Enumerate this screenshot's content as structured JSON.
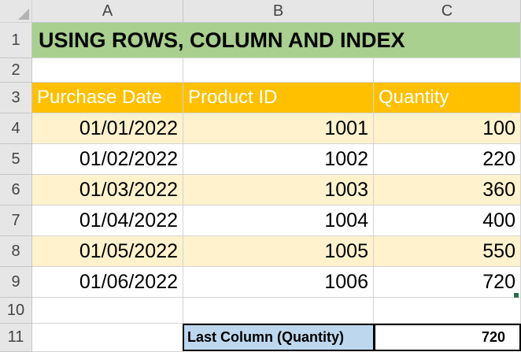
{
  "columns": [
    "A",
    "B",
    "C"
  ],
  "rows": [
    "1",
    "2",
    "3",
    "4",
    "5",
    "6",
    "7",
    "8",
    "9",
    "10",
    "11"
  ],
  "title": "USING ROWS, COLUMN AND INDEX",
  "table": {
    "headers": [
      "Purchase Date",
      "Product ID",
      "Quantity"
    ],
    "rows": [
      {
        "date": "01/01/2022",
        "id": "1001",
        "qty": "100"
      },
      {
        "date": "01/02/2022",
        "id": "1002",
        "qty": "220"
      },
      {
        "date": "01/03/2022",
        "id": "1003",
        "qty": "360"
      },
      {
        "date": "01/04/2022",
        "id": "1004",
        "qty": "400"
      },
      {
        "date": "01/05/2022",
        "id": "1005",
        "qty": "550"
      },
      {
        "date": "01/06/2022",
        "id": "1006",
        "qty": "720"
      }
    ]
  },
  "summary": {
    "label": "Last Column (Quantity)",
    "value": "720"
  },
  "colors": {
    "title_fill": "#a9d08e",
    "header_fill": "#ffc000",
    "band_fill": "#fff2cc",
    "summary_label_fill": "#bdd7ee"
  }
}
